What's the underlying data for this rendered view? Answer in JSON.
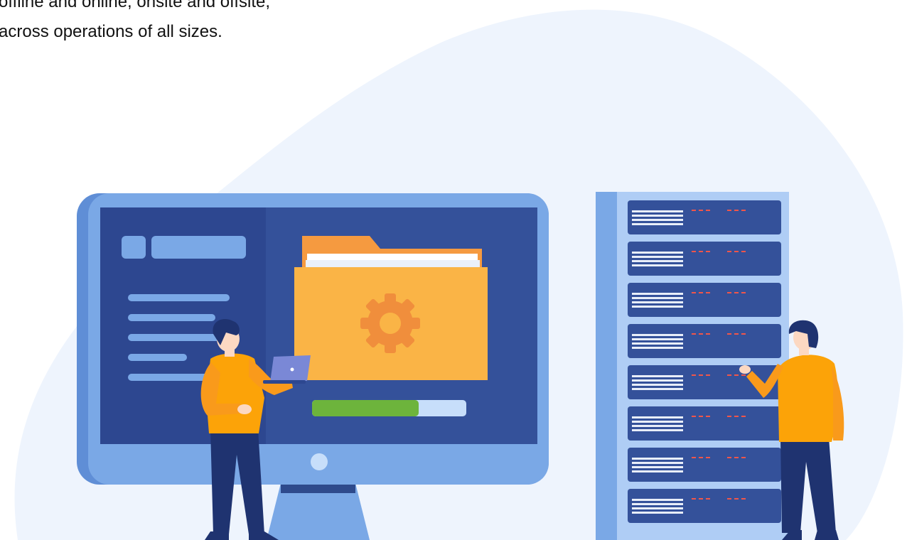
{
  "intro": {
    "line1": "offline and online, onsite and offsite,",
    "line2": "across operations of all sizes."
  },
  "illustration": {
    "icons": [
      "folder-icon",
      "gear-icon",
      "laptop-icon",
      "server-rack",
      "monitor",
      "person"
    ],
    "colors": {
      "background_blob": "#EEF4FD",
      "monitor_frame": "#7AA8E6",
      "monitor_screen": "#34519A",
      "folder": "#FAB446",
      "folder_back": "#F59A40",
      "gear": "#F08E3C",
      "progress_fill": "#6DB43C",
      "progress_track": "#C7DEFA",
      "server_frame": "#8FB8EC",
      "server_unit": "#34519A",
      "shirt": "#FCA308",
      "pants": "#1F3370",
      "hair": "#1F3370",
      "skin": "#FCD8C2"
    },
    "progress": 0.69
  }
}
